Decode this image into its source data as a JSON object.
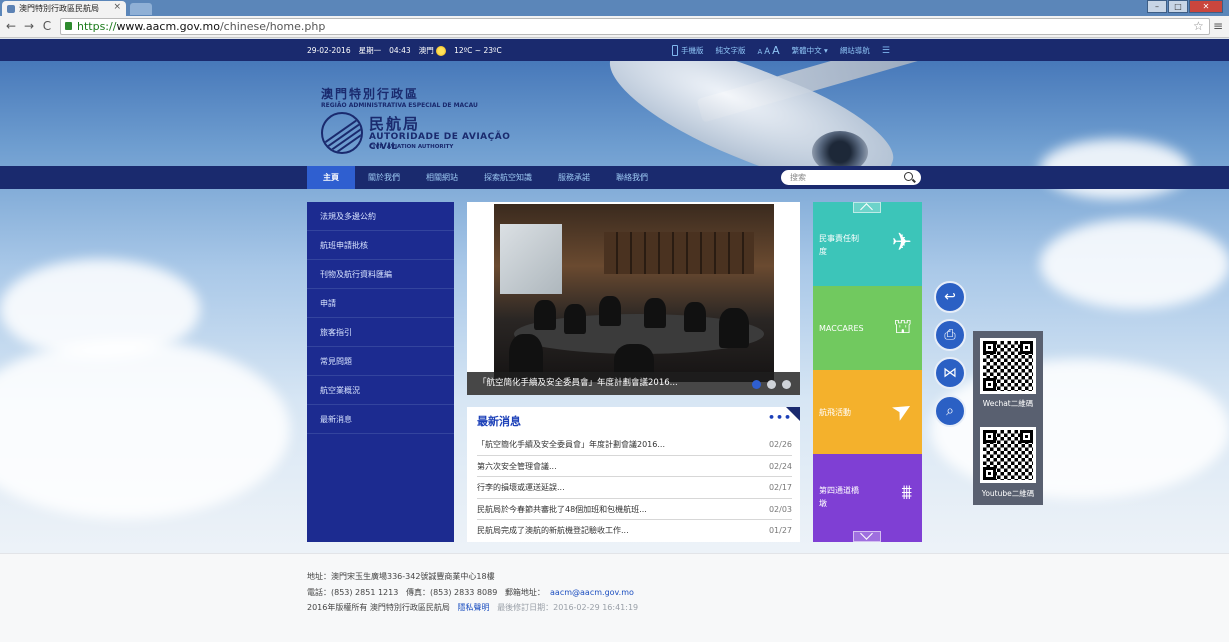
{
  "browser": {
    "tab_title": "澳門特別行政區民航局",
    "tab_close": "×",
    "url_scheme": "https://",
    "url_host": "www.aacm.gov.mo",
    "url_path": "/chinese/home.php",
    "back": "←",
    "forward": "→",
    "reload": "C",
    "star": "☆",
    "menu": "≡"
  },
  "topbar": {
    "date": "29-02-2016",
    "weekday": "星期一",
    "time": "04:43",
    "city": "澳門",
    "weather_icon": "sun-icon",
    "temperature": "12ºC ~ 23ºC",
    "mobile": "手機版",
    "text_version": "純文字版",
    "font_small": "A",
    "font_medium": "A",
    "font_large": "A",
    "language": "繁體中文 ▾",
    "sitemap": "網站導航",
    "rss_icon": "rss-icon"
  },
  "logo": {
    "cn_region": "澳門特別行政區",
    "pt_region": "REGIÃO ADMINISTRATIVA ESPECIAL DE MACAU",
    "cn_name": "民航局",
    "pt_name": "AUTORIDADE DE AVIAÇÃO CIVIL",
    "en_name": "CIVIL AVIATION AUTHORITY"
  },
  "nav": {
    "items": [
      {
        "label": "主頁",
        "active": true
      },
      {
        "label": "關於我們"
      },
      {
        "label": "相關網站"
      },
      {
        "label": "探索航空知識"
      },
      {
        "label": "服務承諾"
      },
      {
        "label": "聯絡我們"
      }
    ],
    "search_placeholder": "搜索"
  },
  "sidebar": {
    "items": [
      {
        "label": "法規及多邊公約"
      },
      {
        "label": "航班申請批核"
      },
      {
        "label": "刊物及航行資料匯編"
      },
      {
        "label": "申請"
      },
      {
        "label": "旅客指引"
      },
      {
        "label": "常見問題"
      },
      {
        "label": "航空業概況"
      },
      {
        "label": "最新消息"
      }
    ]
  },
  "banner": {
    "caption": "「航空簡化手續及安全委員會」年度計劃會議2016...",
    "slides": 3,
    "active_slide": 1
  },
  "news": {
    "title": "最新消息",
    "more": "•••",
    "items": [
      {
        "title": "「航空簡化手續及安全委員會」年度計劃會議2016...",
        "date": "02/26"
      },
      {
        "title": "第六次安全管理會議...",
        "date": "02/24"
      },
      {
        "title": "行李的損壞或運送延誤...",
        "date": "02/17"
      },
      {
        "title": "民航局於今春節共審批了48個加班和包機航班...",
        "date": "02/03"
      },
      {
        "title": "民航局完成了澳航的新航機登記驗收工作...",
        "date": "01/27"
      }
    ]
  },
  "tiles": [
    {
      "label": "民事責任制度",
      "icon": "airplane-icon",
      "glyph": "✈",
      "color": "#3cc5b9"
    },
    {
      "label": "MACCARES",
      "icon": "siren-icon",
      "glyph": "🚨",
      "color": "#71c95f"
    },
    {
      "label": "航飛活動",
      "icon": "paper-plane-icon",
      "glyph": "➤",
      "color": "#f4b12c"
    },
    {
      "label": "第四通道橋墩",
      "icon": "bridge-icon",
      "glyph": "⩩",
      "color": "#7f3fd4"
    }
  ],
  "floating": {
    "back_icon": "back-arrow-icon",
    "back_glyph": "↩",
    "print_icon": "print-icon",
    "print_glyph": "⎙",
    "share_icon": "share-icon",
    "share_glyph": "⋈",
    "qr_icon": "qr-search-icon",
    "qr_glyph": "⌕",
    "wechat_label": "Wechat二維碼",
    "youtube_label": "Youtube二維碼"
  },
  "footer": {
    "address": "地址：澳門宋玉生廣場336-342號誠豐商業中心18樓",
    "phone": "電話：(853) 2851 1213",
    "fax": "傳真：(853) 2833 8089",
    "email_label": "郵箱地址：",
    "email": "aacm@aacm.gov.mo",
    "copyright": "2016年版權所有 澳門特別行政區民航局",
    "privacy": "隱私聲明",
    "last_modified": "最後修訂日期：2016-02-29 16:41:19"
  }
}
